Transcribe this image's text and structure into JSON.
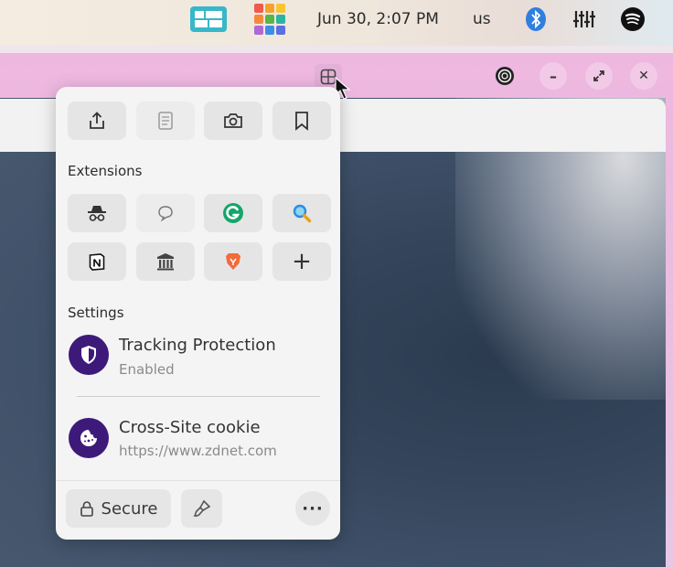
{
  "topbar": {
    "clock": "Jun 30, 2:07 PM",
    "language": "us",
    "icons": [
      "window-switcher-icon",
      "app-grid-icon",
      "bluetooth-icon",
      "mixer-icon",
      "spotify-icon"
    ]
  },
  "window": {
    "controls": [
      "extensions-toolbar-icon",
      "media-icon",
      "minimize-icon",
      "maximize-icon",
      "close-icon"
    ],
    "minimize_glyph": "–",
    "close_glyph": "✕"
  },
  "popup": {
    "actions": [
      "share-icon",
      "reader-mode-icon",
      "screenshot-icon",
      "bookmark-icon"
    ],
    "extensions_title": "Extensions",
    "extensions": [
      "incognito-extension-icon",
      "chat-extension-icon",
      "grammarly-icon",
      "search-extension-icon",
      "notion-icon",
      "archive-extension-icon",
      "brave-extension-icon",
      "add-extension-icon"
    ],
    "add_glyph": "+",
    "settings_title": "Settings",
    "settings": [
      {
        "title": "Tracking Protection",
        "subtitle": "Enabled"
      },
      {
        "title": "Cross-Site cookie",
        "subtitle": "https://www.zdnet.com"
      }
    ],
    "secure_label": "Secure",
    "more_label": "···"
  },
  "colors": {
    "accent_purple": "#3d1a7a",
    "grammarly_green": "#15a56b",
    "window_pink": "#eeb7df"
  }
}
